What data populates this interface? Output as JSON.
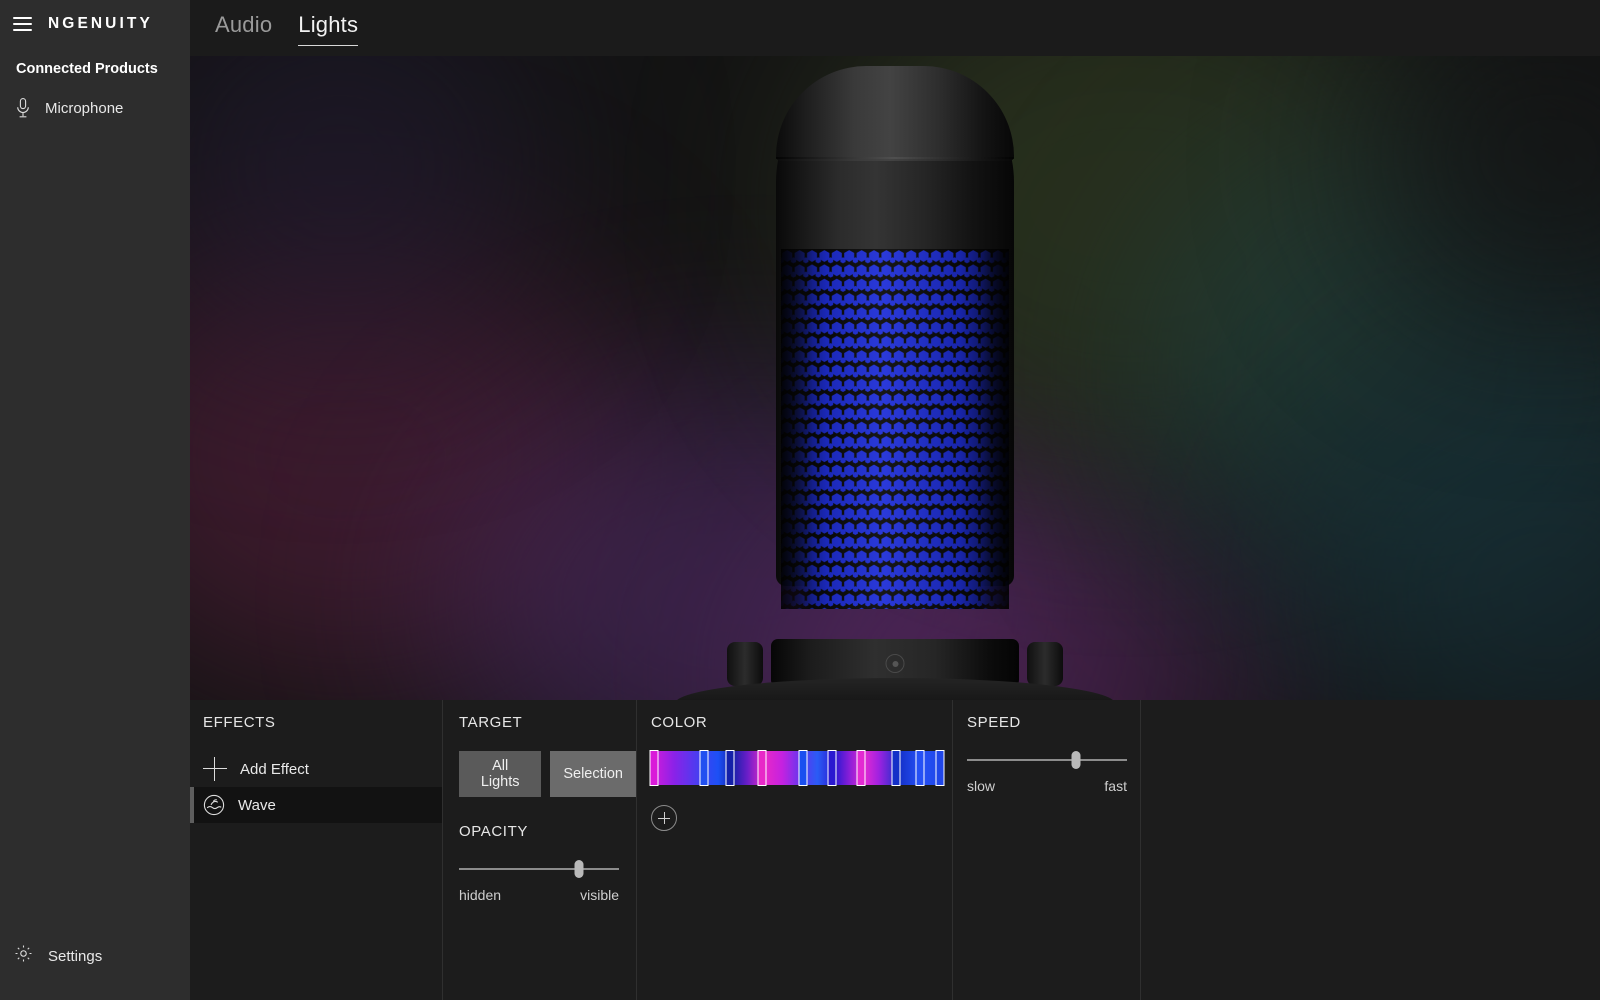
{
  "sidebar": {
    "menu_icon": "hamburger-icon",
    "brand": "NGENUITY",
    "section_title": "Connected Products",
    "items": [
      {
        "label": "Microphone",
        "icon": "microphone-icon"
      }
    ],
    "settings": {
      "label": "Settings",
      "icon": "gear-icon"
    }
  },
  "header": {
    "tabs": [
      {
        "label": "Audio",
        "active": false
      },
      {
        "label": "Lights",
        "active": true
      }
    ]
  },
  "stage": {
    "device": "microphone-product-render",
    "led_color": "#1f2fd8",
    "backdrop_colors": [
      "#3a2050",
      "#4a2a5e",
      "#2b3a28",
      "#1d3340",
      "#50203a"
    ]
  },
  "panel": {
    "effects": {
      "title": "EFFECTS",
      "items": [
        {
          "label": "Add Effect",
          "icon": "plus-icon",
          "selected": false
        },
        {
          "label": "Wave",
          "icon": "wave-icon",
          "selected": true
        }
      ]
    },
    "target": {
      "title": "TARGET",
      "buttons": [
        {
          "label": "All Lights",
          "active": true
        },
        {
          "label": "Selection",
          "active": false
        }
      ]
    },
    "opacity": {
      "title": "OPACITY",
      "min_label": "hidden",
      "max_label": "visible",
      "value_pct": 75
    },
    "color": {
      "title": "COLOR",
      "add_icon": "plus-circle-icon",
      "stops": [
        {
          "pos_pct": 1,
          "color": "#d91ad9"
        },
        {
          "pos_pct": 18,
          "color": "#2150f0"
        },
        {
          "pos_pct": 27,
          "color": "#1420a8"
        },
        {
          "pos_pct": 38,
          "color": "#e828c8"
        },
        {
          "pos_pct": 52,
          "color": "#1a4ff0"
        },
        {
          "pos_pct": 62,
          "color": "#2a18d0"
        },
        {
          "pos_pct": 72,
          "color": "#e32ad2"
        },
        {
          "pos_pct": 84,
          "color": "#1430c8"
        },
        {
          "pos_pct": 92,
          "color": "#2550f5"
        },
        {
          "pos_pct": 99,
          "color": "#2046e8"
        }
      ],
      "gradient_css": "linear-gradient(90deg,#d91ad9 0%,#8a22e8 8%,#3a44f2 18%,#1c50f5 23%,#1420a8 28%,#6a1ec8 33%,#e828c8 39%,#c422e0 45%,#5a38f0 52%,#2a5cf5 57%,#2a18d0 63%,#8a1ed8 68%,#e32ad2 73%,#a022e0 78%,#1430c8 85%,#2550f5 92%,#2046e8 100%)"
    },
    "speed": {
      "title": "SPEED",
      "min_label": "slow",
      "max_label": "fast",
      "value_pct": 68
    }
  }
}
